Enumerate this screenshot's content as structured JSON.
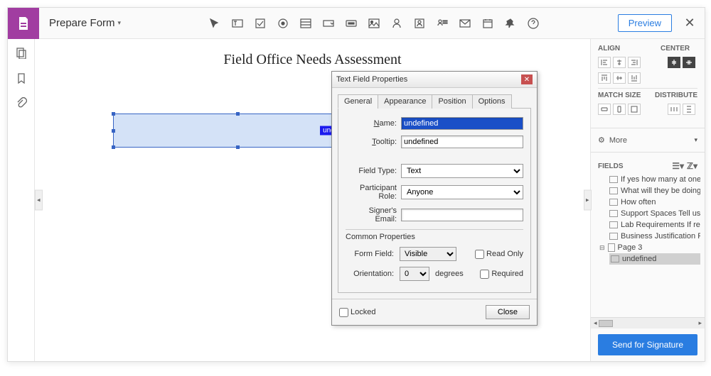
{
  "topbar": {
    "mode_label": "Prepare Form",
    "preview_label": "Preview"
  },
  "document": {
    "title": "Field Office Needs Assessment",
    "selected_field_label": "undefined"
  },
  "rightpanel": {
    "align_label": "ALIGN",
    "center_label": "CENTER",
    "match_label": "MATCH SIZE",
    "distribute_label": "DISTRIBUTE",
    "more_label": "More",
    "fields_label": "FIELDS",
    "field_items": [
      "If yes how many at one",
      "What will they be doing",
      "How often",
      "Support Spaces Tell us",
      "Lab Requirements If req",
      "Business Justification  R"
    ],
    "page_label": "Page 3",
    "selected_field": "undefined",
    "send_label": "Send for Signature"
  },
  "dialog": {
    "title": "Text Field Properties",
    "tabs": [
      "General",
      "Appearance",
      "Position",
      "Options"
    ],
    "active_tab": 0,
    "name_label": "Name:",
    "name_value": "undefined",
    "tooltip_label": "Tooltip:",
    "tooltip_value": "undefined",
    "fieldtype_label": "Field Type:",
    "fieldtype_value": "Text",
    "role_label": "Participant Role:",
    "role_value": "Anyone",
    "email_label": "Signer's Email:",
    "email_value": "",
    "common_label": "Common Properties",
    "formfield_label": "Form Field:",
    "formfield_value": "Visible",
    "readonly_label": "Read Only",
    "orientation_label": "Orientation:",
    "orientation_value": "0",
    "degrees_label": "degrees",
    "required_label": "Required",
    "locked_label": "Locked",
    "close_label": "Close"
  }
}
